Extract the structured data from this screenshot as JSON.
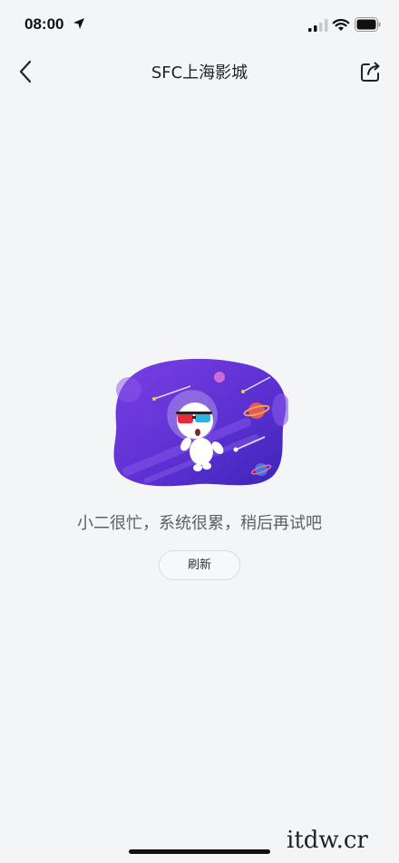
{
  "status_bar": {
    "time": "08:00"
  },
  "nav": {
    "title": "SFC上海影城"
  },
  "error": {
    "message": "小二很忙，系统很累，稍后再试吧",
    "refresh_label": "刷新"
  },
  "watermark": "itdw.cr",
  "colors": {
    "background": "#f4f5f7",
    "illustration_purple": "#5b2fd1",
    "glasses_red": "#e8283a",
    "glasses_blue": "#2bb3e6"
  },
  "icons": [
    "location-arrow-icon",
    "signal-icon",
    "wifi-icon",
    "battery-icon",
    "back-icon",
    "share-icon"
  ]
}
